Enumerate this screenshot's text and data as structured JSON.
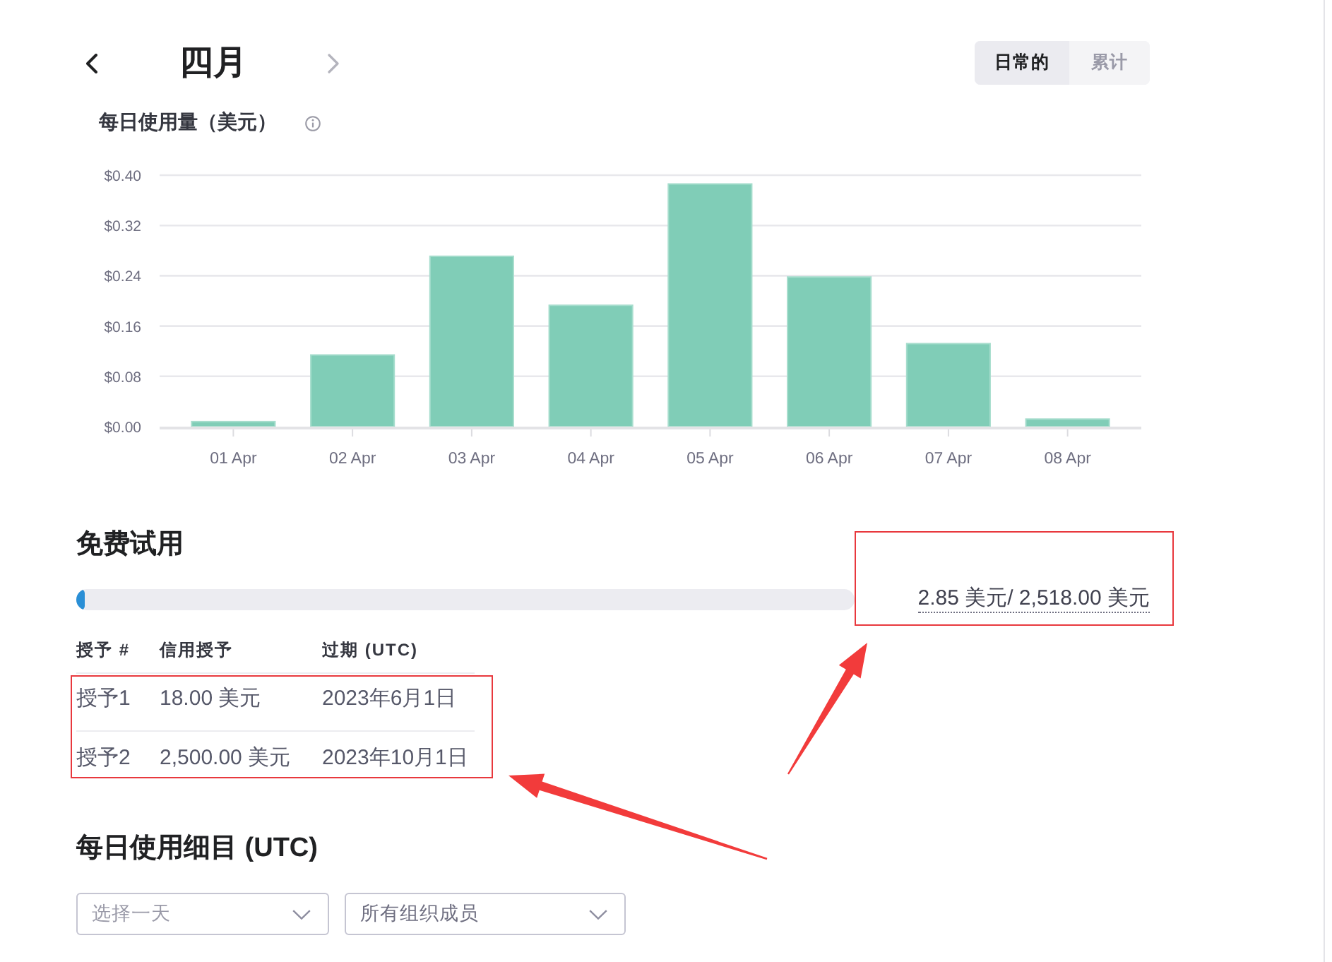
{
  "header": {
    "prev_button": {
      "disabled": false
    },
    "title": "四月",
    "next_button": {
      "disabled": true
    },
    "view_toggle": [
      {
        "label": "日常的",
        "selected": true
      },
      {
        "label": "累计",
        "selected": false
      }
    ]
  },
  "usage_chart": {
    "chart_data": {
      "type": "bar",
      "title": "每日使用量（美元）",
      "categories": [
        "01 Apr",
        "02 Apr",
        "03 Apr",
        "04 Apr",
        "05 Apr",
        "06 Apr",
        "07 Apr",
        "08 Apr"
      ],
      "values": [
        0.008,
        0.114,
        0.271,
        0.193,
        0.386,
        0.238,
        0.132,
        0.012
      ],
      "ylim": [
        0,
        0.4
      ],
      "yticks": [
        {
          "value": 0,
          "label": "$0.00"
        },
        {
          "value": 0.08,
          "label": "$0.08"
        },
        {
          "value": 0.16,
          "label": "$0.16"
        },
        {
          "value": 0.24,
          "label": "$0.24"
        },
        {
          "value": 0.32,
          "label": "$0.32"
        },
        {
          "value": 0.4,
          "label": "$0.40"
        }
      ],
      "grid": true
    }
  },
  "free_trial": {
    "title": "免费试用",
    "usage": {
      "level": 0.0011,
      "text": "2.85 美元/ 2,518.00 美元",
      "highlighted": true
    },
    "grants_table": {
      "columns": [
        "授予 #",
        "信用授予",
        "过期 (UTC)"
      ],
      "rows": [
        [
          "授予1",
          "18.00 美元",
          "2023年6月1日"
        ],
        [
          "授予2",
          "2,500.00 美元",
          "2023年10月1日"
        ]
      ],
      "highlighted": true
    }
  },
  "daily_breakdown": {
    "title": "每日使用细目 (UTC)",
    "filters": [
      {
        "placeholder": "选择一天"
      },
      {
        "value": "所有组织成员"
      }
    ]
  }
}
